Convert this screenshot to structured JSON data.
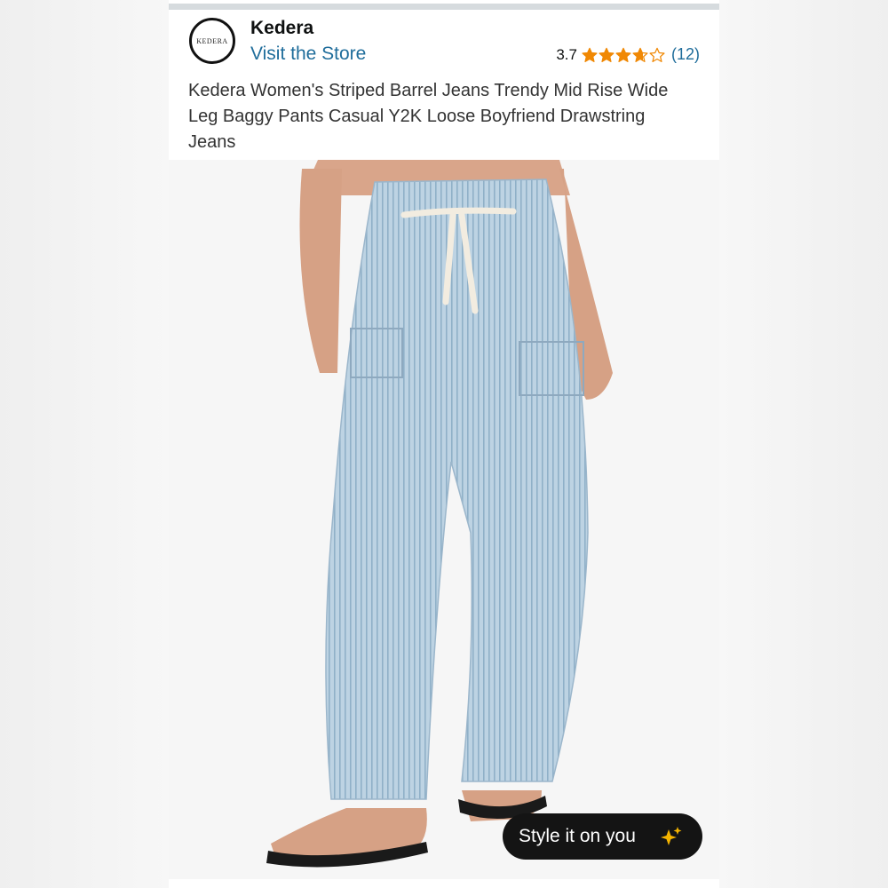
{
  "store": {
    "logo_text": "KEDERA",
    "name": "Kedera",
    "visit_label": "Visit the Store"
  },
  "rating": {
    "value": "3.7",
    "stars_out_of_5": 3.7,
    "count": "(12)"
  },
  "product": {
    "title": "Kedera Women's Striped Barrel Jeans Trendy Mid Rise Wide Leg Baggy Pants Casual Y2K Loose Boyfriend Drawstring Jeans"
  },
  "actions": {
    "style_it_label": "Style it on you"
  },
  "colors": {
    "link": "#1f6d9b",
    "star": "#f08804",
    "button_bg": "#141414",
    "sparkle": "#f5b400",
    "denim": "#b8cfe0"
  },
  "icons": {
    "star": "star-icon",
    "sparkle": "sparkle-icon"
  }
}
